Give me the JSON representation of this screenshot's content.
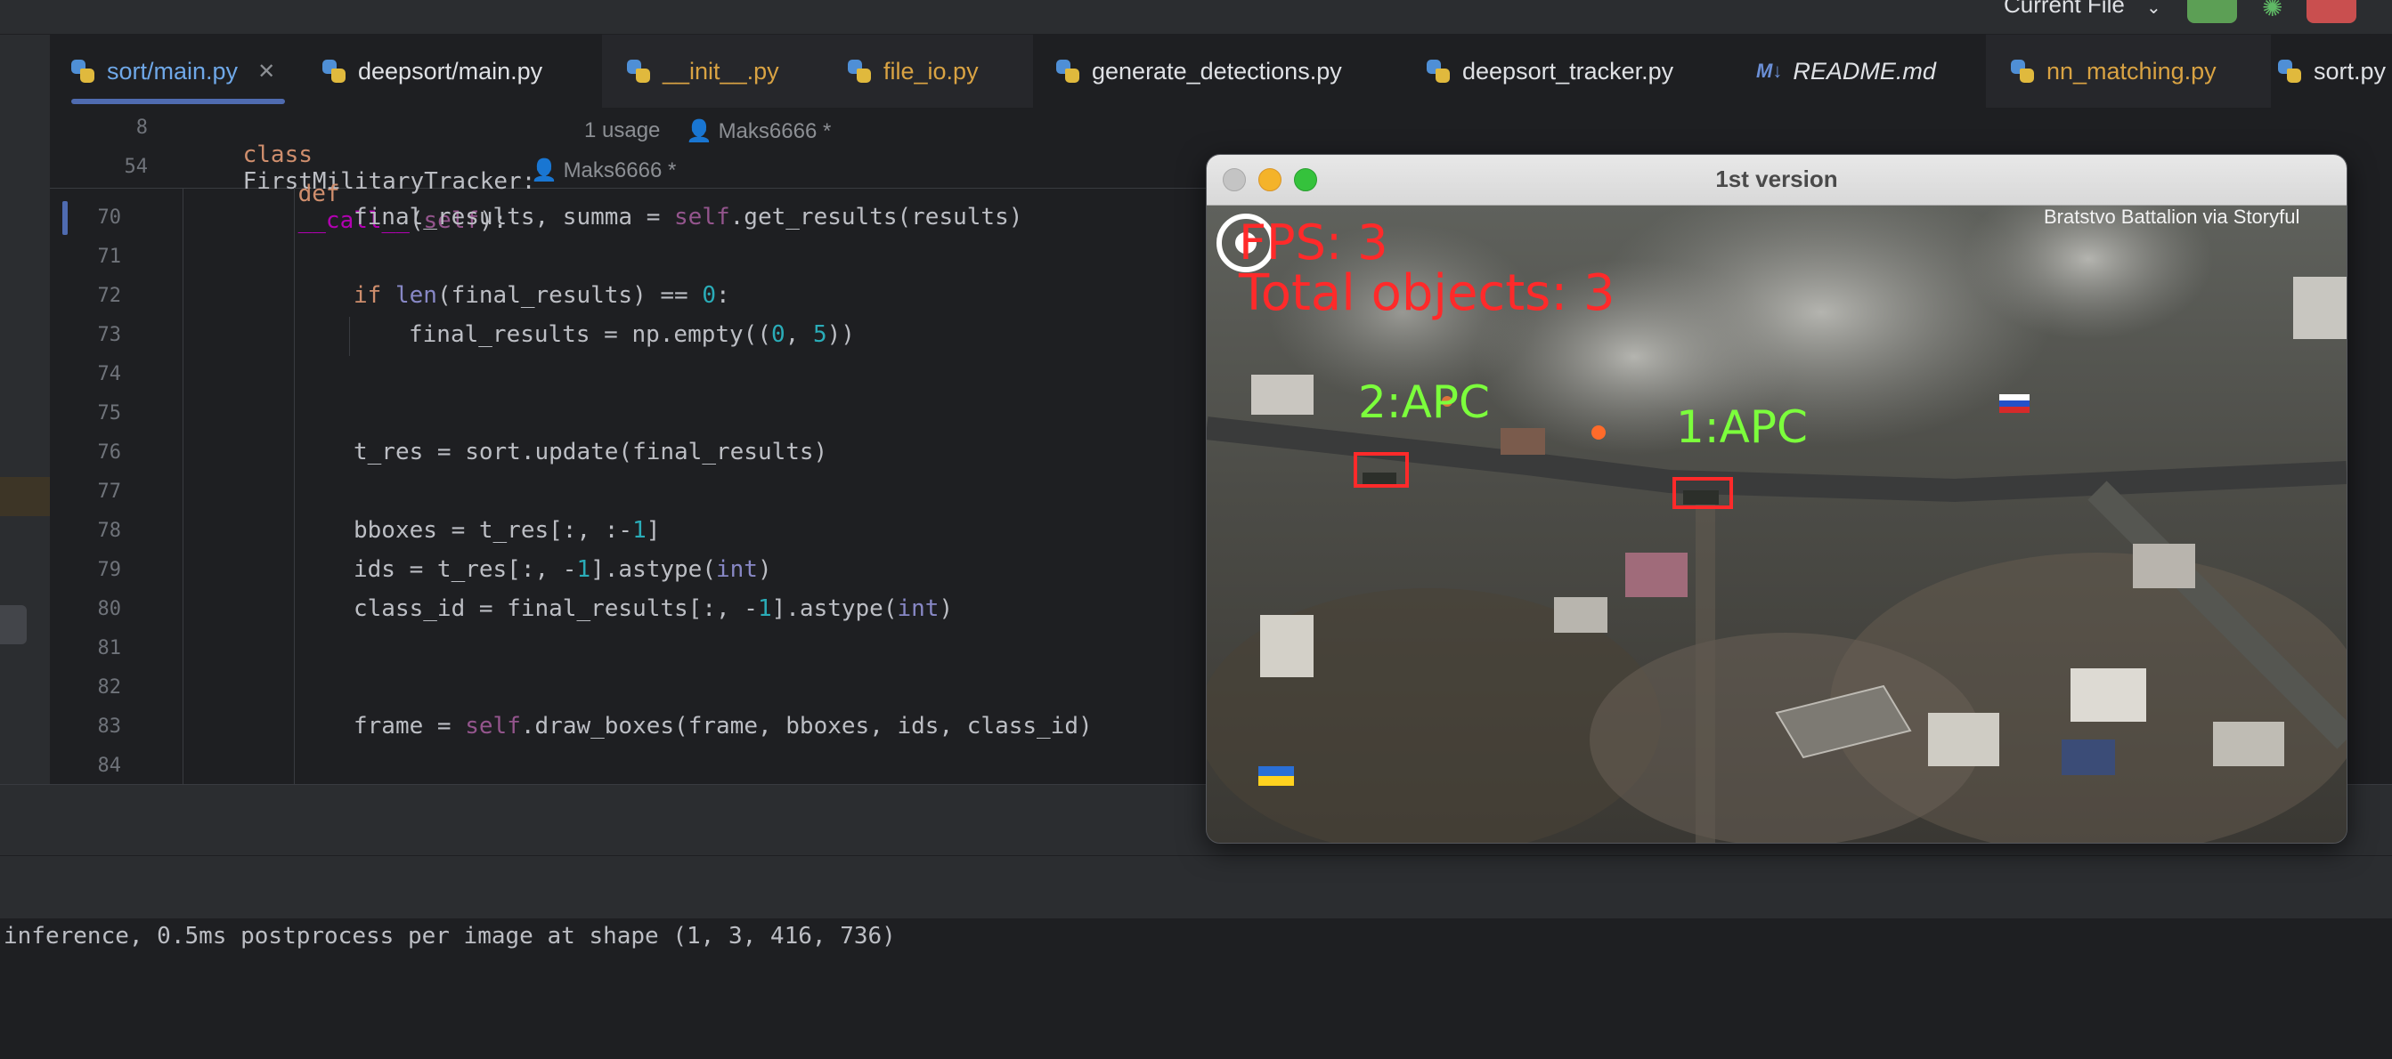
{
  "toolbar": {
    "run_config": "Current File"
  },
  "tabs": [
    {
      "label": "sort/main.py",
      "state": "active"
    },
    {
      "label": "deepsort/main.py",
      "state": "normal"
    },
    {
      "label": "__init__.py",
      "state": "modified"
    },
    {
      "label": "file_io.py",
      "state": "modified"
    },
    {
      "label": "generate_detections.py",
      "state": "normal"
    },
    {
      "label": "deepsort_tracker.py",
      "state": "normal"
    },
    {
      "label": "README.md",
      "state": "normal"
    },
    {
      "label": "nn_matching.py",
      "state": "modified"
    },
    {
      "label": "sort.py",
      "state": "normal"
    }
  ],
  "readme_badge": "M↓",
  "sticky": {
    "line1_no": "8",
    "line1_kw": "class",
    "line1_name": "FirstMilitaryTracker:",
    "line1_usage": "1 usage",
    "line1_author": "Maks6666 *",
    "line2_no": "54",
    "line2_kw": "def",
    "line2_name": "__call__",
    "line2_params_open": "(",
    "line2_self": "self",
    "line2_params_close": "):",
    "line2_author": "Maks6666 *"
  },
  "code": {
    "l70": {
      "no": "70",
      "a": "final_results, summa = ",
      "self": "self",
      "b": ".get_results(results)"
    },
    "l71": {
      "no": "71"
    },
    "l72": {
      "no": "72",
      "kw": "if ",
      "bi": "len",
      "b": "(final_results) == ",
      "num": "0",
      "c": ":"
    },
    "l73": {
      "no": "73",
      "a": "final_results = np.empty((",
      "n1": "0",
      "sep": ", ",
      "n2": "5",
      "c": "))"
    },
    "l74": {
      "no": "74"
    },
    "l75": {
      "no": "75"
    },
    "l76": {
      "no": "76",
      "a": "t_res = sort.update(final_results)"
    },
    "l77": {
      "no": "77"
    },
    "l78": {
      "no": "78",
      "a": "bboxes = t_res[:, :-",
      "num": "1",
      "c": "]"
    },
    "l79": {
      "no": "79",
      "a": "ids = t_res[:, -",
      "num": "1",
      "b": "].astype(",
      "bi": "int",
      "c": ")"
    },
    "l80": {
      "no": "80",
      "a": "class_id = final_results[:, -",
      "num": "1",
      "b": "].astype(",
      "bi": "int",
      "c": ")"
    },
    "l81": {
      "no": "81"
    },
    "l82": {
      "no": "82"
    },
    "l83": {
      "no": "83",
      "a": "frame = ",
      "self": "self",
      "b": ".draw_boxes(frame, bboxes, ids, class_id)"
    },
    "l84": {
      "no": "84"
    }
  },
  "console": {
    "text": "inference, 0.5ms postprocess per image at shape (1, 3, 416, 736)"
  },
  "video_window": {
    "title": "1st version",
    "fps_text": "FPS: 3",
    "total_text": "Total objects: 3",
    "credit": "Bratstvo Battalion via Storyful",
    "label1": "2:APC",
    "label2": "1:APC",
    "colors": {
      "overlay_red": "#ff2a2a",
      "label_green": "#7cff3c"
    }
  }
}
